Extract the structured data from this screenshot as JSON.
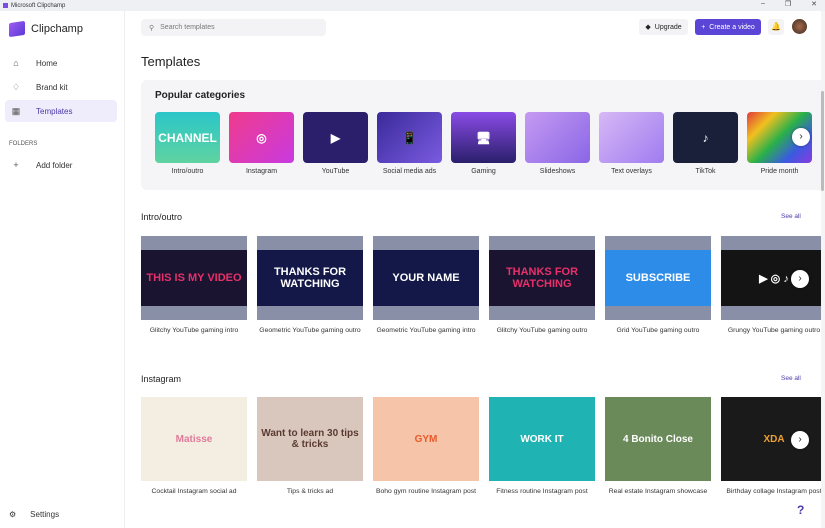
{
  "window": {
    "title": "Microsoft Clipchamp",
    "min": "–",
    "max": "❐",
    "close": "✕"
  },
  "app": {
    "name": "Clipchamp"
  },
  "sidebar": {
    "items": [
      {
        "label": "Home",
        "icon": "⌂"
      },
      {
        "label": "Brand kit",
        "icon": "♢"
      },
      {
        "label": "Templates",
        "icon": "▦"
      }
    ],
    "folders_heading": "FOLDERS",
    "add_folder": "Add folder",
    "settings": "Settings"
  },
  "header": {
    "search_placeholder": "Search templates",
    "upgrade": "Upgrade",
    "create": "Create a video",
    "bell": "🔔"
  },
  "page": {
    "title": "Templates"
  },
  "popular": {
    "heading": "Popular categories",
    "items": [
      {
        "label": "Intro/outro",
        "bg": "linear-gradient(#2bc6c9,#5fd3a0)",
        "text": "CHANNEL"
      },
      {
        "label": "Instagram",
        "bg": "linear-gradient(135deg,#f03b8c,#c93ae0)",
        "text": "◎"
      },
      {
        "label": "YouTube",
        "bg": "#2b1f6b",
        "text": "▶"
      },
      {
        "label": "Social media ads",
        "bg": "linear-gradient(135deg,#3a2a9a,#7a5be0)",
        "text": "📱"
      },
      {
        "label": "Gaming",
        "bg": "linear-gradient(#8a4be6,#2a1f6b)",
        "text": "🖥"
      },
      {
        "label": "Slideshows",
        "bg": "linear-gradient(135deg,#c59af2,#8a66e6)",
        "text": ""
      },
      {
        "label": "Text overlays",
        "bg": "linear-gradient(135deg,#d7b8f5,#9f7cf0)",
        "text": ""
      },
      {
        "label": "TikTok",
        "bg": "#1a1f3a",
        "text": "♪"
      },
      {
        "label": "Pride month",
        "bg": "linear-gradient(135deg,#e23a3a,#f0c020,#2ab04a,#3a5ae0,#8a3ae0)",
        "text": ""
      }
    ]
  },
  "intro": {
    "heading": "Intro/outro",
    "see_all": "See all",
    "items": [
      {
        "label": "Glitchy YouTube gaming intro",
        "bg": "#1a1430",
        "color": "#e8306a",
        "text": "THIS IS MY VIDEO"
      },
      {
        "label": "Geometric YouTube gaming outro",
        "bg": "#141848",
        "color": "#fff",
        "text": "THANKS FOR WATCHING"
      },
      {
        "label": "Geometric YouTube gaming intro",
        "bg": "#141848",
        "color": "#fff",
        "text": "YOUR NAME"
      },
      {
        "label": "Glitchy YouTube gaming outro",
        "bg": "#1a1430",
        "color": "#e8306a",
        "text": "THANKS FOR WATCHING"
      },
      {
        "label": "Grid YouTube gaming outro",
        "bg": "#2d8ce8",
        "color": "#fff",
        "text": "SUBSCRIBE"
      },
      {
        "label": "Grungy YouTube gaming outro",
        "bg": "#141414",
        "color": "#fff",
        "text": "▶ ◎ ♪"
      }
    ]
  },
  "instagram": {
    "heading": "Instagram",
    "see_all": "See all",
    "items": [
      {
        "label": "Cocktail Instagram social ad",
        "bg": "#f3ede2",
        "color": "#e07a9a",
        "text": "Matisse"
      },
      {
        "label": "Tips & tricks ad",
        "bg": "#d9c7bd",
        "color": "#5a3a30",
        "text": "Want to learn 30 tips & tricks"
      },
      {
        "label": "Boho gym routine Instagram post",
        "bg": "#f6c4a8",
        "color": "#e85a2a",
        "text": "GYM"
      },
      {
        "label": "Fitness routine Instagram post",
        "bg": "#1fb3b3",
        "color": "#fff",
        "text": "WORK IT"
      },
      {
        "label": "Real estate Instagram showcase",
        "bg": "#6a8a5a",
        "color": "#fff",
        "text": "4 Bonito Close"
      },
      {
        "label": "Birthday collage Instagram post",
        "bg": "#1a1a1a",
        "color": "#f0a030",
        "text": "XDA"
      }
    ]
  },
  "help": "?"
}
